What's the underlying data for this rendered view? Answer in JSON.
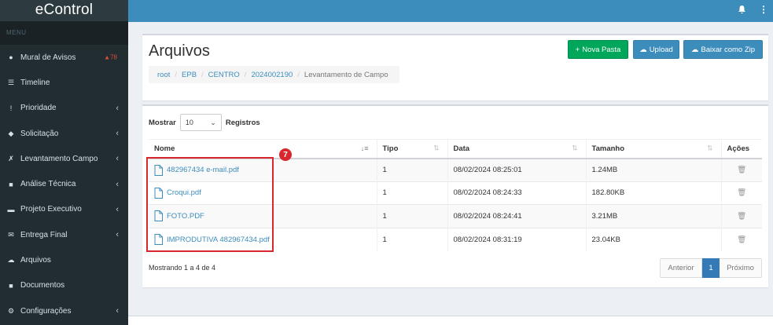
{
  "app": {
    "brand": "eControl"
  },
  "sidebar": {
    "menu_header": "MENU",
    "items": [
      {
        "label": "Mural de Avisos",
        "icon": "comment-icon",
        "badge": "78"
      },
      {
        "label": "Timeline",
        "icon": "list-icon"
      },
      {
        "label": "Prioridade",
        "icon": "exclamation-icon",
        "chevron": "‹"
      },
      {
        "label": "Solicitação",
        "icon": "tag-icon",
        "chevron": "‹"
      },
      {
        "label": "Levantamento Campo",
        "icon": "thumbtack-icon",
        "chevron": "‹"
      },
      {
        "label": "Análise Técnica",
        "icon": "file-icon",
        "chevron": "‹"
      },
      {
        "label": "Projeto Executivo",
        "icon": "briefcase-icon",
        "chevron": "‹"
      },
      {
        "label": "Entrega Final",
        "icon": "envelope-icon",
        "chevron": "‹"
      },
      {
        "label": "Arquivos",
        "icon": "cloud-icon"
      },
      {
        "label": "Documentos",
        "icon": "document-icon"
      },
      {
        "label": "Configurações",
        "icon": "cogs-icon",
        "chevron": "‹"
      }
    ]
  },
  "header": {
    "title": "Arquivos",
    "buttons": {
      "new_folder": "Nova Pasta",
      "upload": "Upload",
      "download_zip": "Baixar como Zip"
    },
    "breadcrumb": [
      "root",
      "EPB",
      "CENTRO",
      "2024002190",
      "Levantamento de Campo"
    ]
  },
  "table_controls": {
    "show_label": "Mostrar",
    "page_size": "10",
    "records_label": "Registros"
  },
  "table": {
    "columns": [
      "Nome",
      "Tipo",
      "Data",
      "Tamanho",
      "Ações"
    ],
    "rows": [
      {
        "name": "482967434 e-mail.pdf",
        "type": "1",
        "date": "08/02/2024 08:25:01",
        "size": "1.24MB"
      },
      {
        "name": "Croqui.pdf",
        "type": "1",
        "date": "08/02/2024 08:24:33",
        "size": "182.80KB"
      },
      {
        "name": "FOTO.PDF",
        "type": "1",
        "date": "08/02/2024 08:24:41",
        "size": "3.21MB"
      },
      {
        "name": "IMPRODUTIVA 482967434.pdf",
        "type": "1",
        "date": "08/02/2024 08:31:19",
        "size": "23.04KB"
      }
    ]
  },
  "footer_info": "Mostrando 1 a 4 de 4",
  "pagination": {
    "prev": "Anterior",
    "current": "1",
    "next": "Próximo"
  },
  "annotation": {
    "marker": "7"
  },
  "colors": {
    "sidebar_bg": "#222d32",
    "topbar_bg": "#3c8dbc",
    "success": "#00a65a",
    "primary": "#3c8dbc",
    "annotation": "#d9272e"
  }
}
